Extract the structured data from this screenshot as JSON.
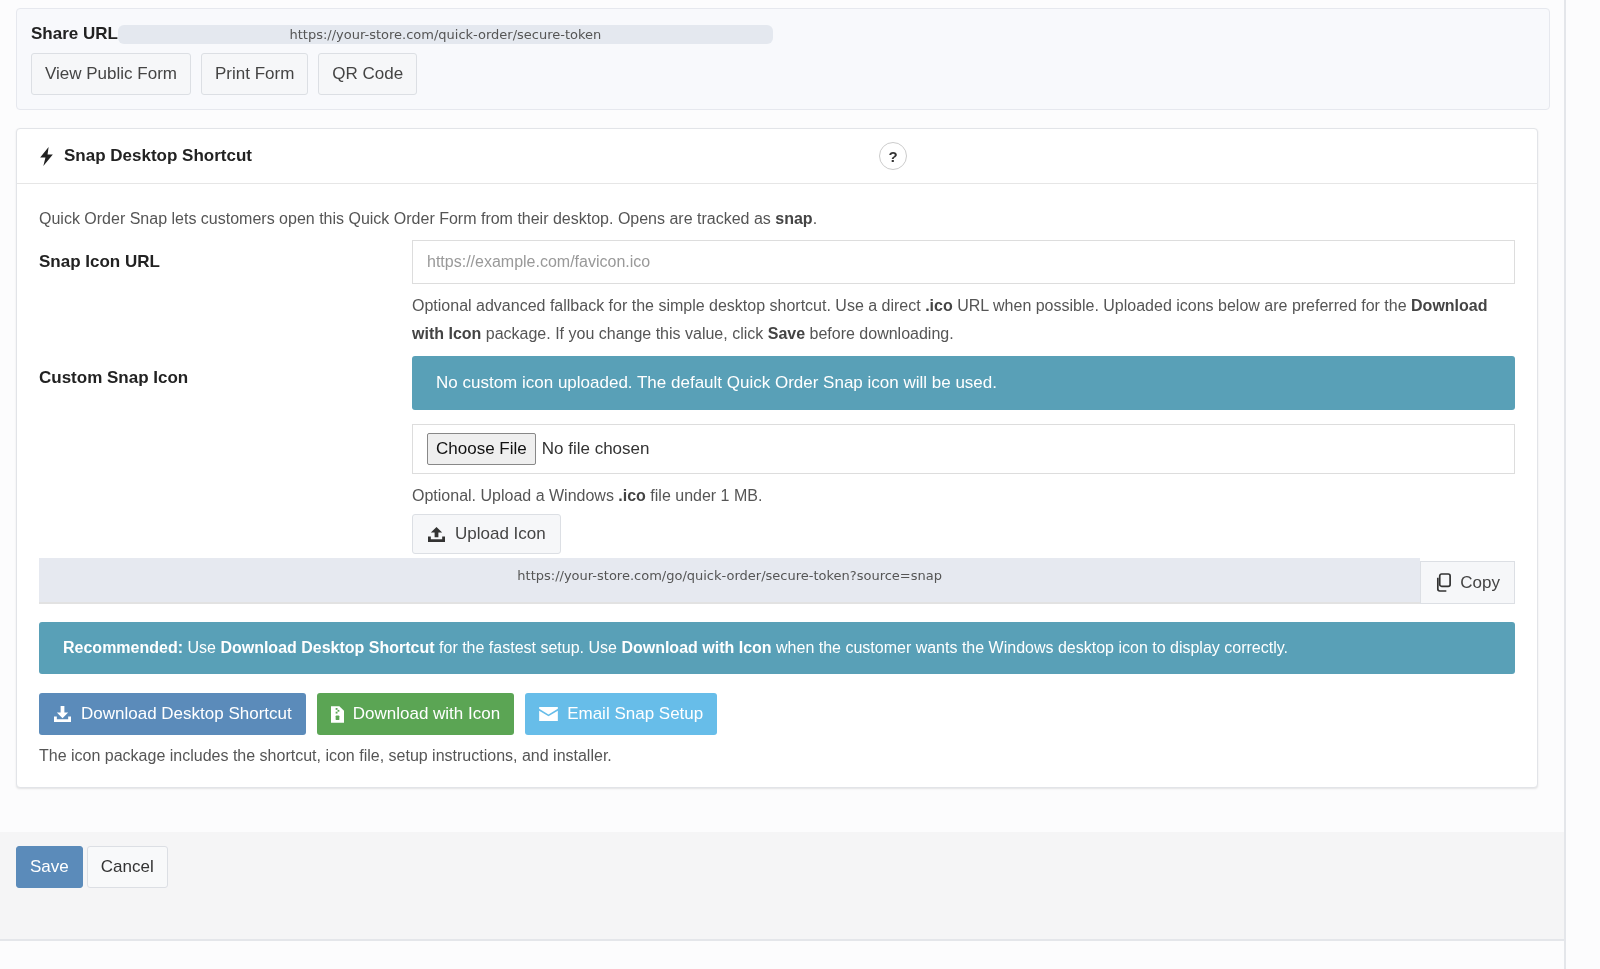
{
  "share": {
    "label": "Share URL",
    "url": "https://your-store.com/quick-order/secure-token",
    "buttons": [
      "View Public Form",
      "Print Form",
      "QR Code"
    ]
  },
  "snap": {
    "title": "Snap Desktop Shortcut",
    "help": "?",
    "intro": "Quick Order Snap lets customers open this Quick Order Form from their desktop. Opens are tracked as **snap**.",
    "icon_url": {
      "label": "Snap Icon URL",
      "placeholder": "https://example.com/favicon.ico",
      "help": "Optional advanced fallback for the simple desktop shortcut. Use a direct **.ico** URL when possible. Uploaded icons below are preferred for the **Download with Icon** package. If you change this value, click **Save** before downloading."
    },
    "custom_icon": {
      "label": "Custom Snap Icon",
      "alert": "No custom icon uploaded. The default Quick Order Snap icon will be used.",
      "file_button": "Choose File",
      "file_status": "No file chosen",
      "help": "Optional. Upload a Windows **.ico** file under 1 MB.",
      "upload_button": "Upload Icon"
    },
    "link": {
      "url": "https://your-store.com/go/quick-order/secure-token?source=snap",
      "copy_button": "Copy"
    },
    "recommendation": "**Recommended:** Use **Download Desktop Shortcut** for the fastest setup. Use **Download with Icon** when the customer wants the Windows desktop icon to display correctly.",
    "actions": [
      {
        "label": "Download Desktop Shortcut",
        "kind": "download"
      },
      {
        "label": "Download with Icon",
        "kind": "package"
      },
      {
        "label": "Email Snap Setup",
        "kind": "email"
      }
    ],
    "note": "The icon package includes the shortcut, icon file, setup instructions, and installer."
  },
  "footer_buttons": [
    {
      "label": "Save",
      "kind": "primary"
    },
    {
      "label": "Cancel",
      "kind": "default"
    }
  ]
}
